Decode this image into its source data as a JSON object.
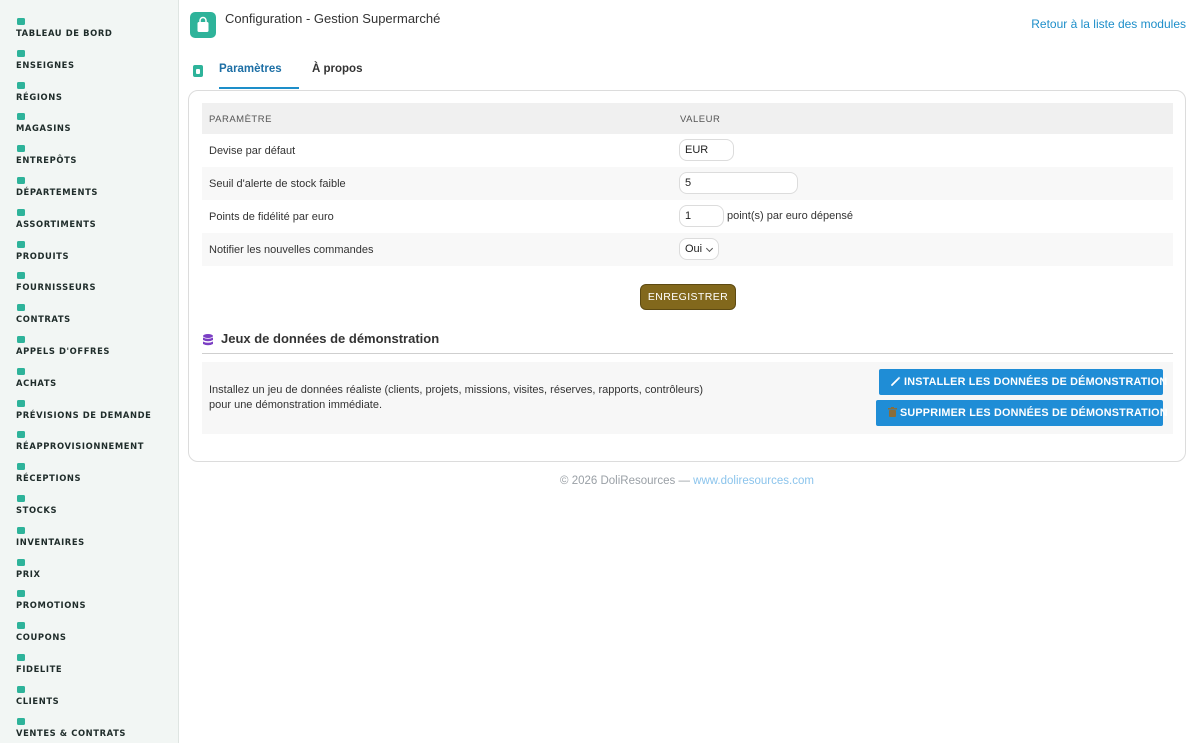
{
  "sidebar": {
    "items": [
      {
        "label": "TABLEAU DE BORD",
        "icon": "dashboard-icon"
      },
      {
        "label": "ENSEIGNES",
        "icon": "flag-icon"
      },
      {
        "label": "RÉGIONS",
        "icon": "map-icon"
      },
      {
        "label": "MAGASINS",
        "icon": "store-icon"
      },
      {
        "label": "ENTREPÔTS",
        "icon": "warehouse-icon"
      },
      {
        "label": "DÉPARTEMENTS",
        "icon": "basket-icon"
      },
      {
        "label": "ASSORTIMENTS",
        "icon": "list-icon"
      },
      {
        "label": "PRODUITS",
        "icon": "box-icon"
      },
      {
        "label": "FOURNISSEURS",
        "icon": "truck-icon"
      },
      {
        "label": "CONTRATS",
        "icon": "document-icon"
      },
      {
        "label": "APPELS D'OFFRES",
        "icon": "gavel-icon"
      },
      {
        "label": "ACHATS",
        "icon": "cart-icon"
      },
      {
        "label": "PRÉVISIONS DE DEMANDE",
        "icon": "chart-line-icon"
      },
      {
        "label": "RÉAPPROVISIONNEMENT",
        "icon": "sync-icon"
      },
      {
        "label": "RÉCEPTIONS",
        "icon": "dolly-icon"
      },
      {
        "label": "STOCKS",
        "icon": "boxes-icon"
      },
      {
        "label": "INVENTAIRES",
        "icon": "clipboard-check-icon"
      },
      {
        "label": "PRIX",
        "icon": "tags-icon"
      },
      {
        "label": "PROMOTIONS",
        "icon": "percent-icon"
      },
      {
        "label": "COUPONS",
        "icon": "ticket-icon"
      },
      {
        "label": "FIDELITE",
        "icon": "id-card-icon"
      },
      {
        "label": "CLIENTS",
        "icon": "user-icon"
      },
      {
        "label": "VENTES & CONTRATS",
        "icon": "receipt-icon"
      }
    ],
    "accent_color": "#2eb39a"
  },
  "header": {
    "title": "Configuration - Gestion Supermarché",
    "back_link": "Retour à la liste des modules",
    "icon": "shopping-bag-icon"
  },
  "tabs": [
    {
      "label": "Paramètres",
      "active": true
    },
    {
      "label": "À propos",
      "active": false
    }
  ],
  "params_table": {
    "headers": [
      "PARAMÈTRE",
      "VALEUR"
    ],
    "rows": [
      {
        "label": "Devise par défaut",
        "value": "EUR"
      },
      {
        "label": "Seuil d'alerte de stock faible",
        "value": "5"
      },
      {
        "label": "Points de fidélité par euro",
        "value": "1",
        "suffix": "point(s) par euro dépensé"
      },
      {
        "label": "Notifier les nouvelles commandes",
        "value": "Oui"
      }
    ]
  },
  "save_button": "ENREGISTRER",
  "demo": {
    "title": "Jeux de données de démonstration",
    "description_line1": "Installez un jeu de données réaliste (clients, projets, missions, visites, réserves, rapports, contrôleurs)",
    "description_line2": "pour une démonstration immédiate.",
    "install_button": "INSTALLER LES DONNÉES DE DÉMONSTRATION",
    "delete_button": "SUPPRIMER LES DONNÉES DE DÉMONSTRATION"
  },
  "footer": {
    "copyright": "© 2026 DoliResources —",
    "link": "www.doliresources.com"
  },
  "colors": {
    "accent": "#2eb39a",
    "link": "#1d8ec9",
    "save_button": "#82681c",
    "demo_buttons": "#1f8dd6"
  }
}
